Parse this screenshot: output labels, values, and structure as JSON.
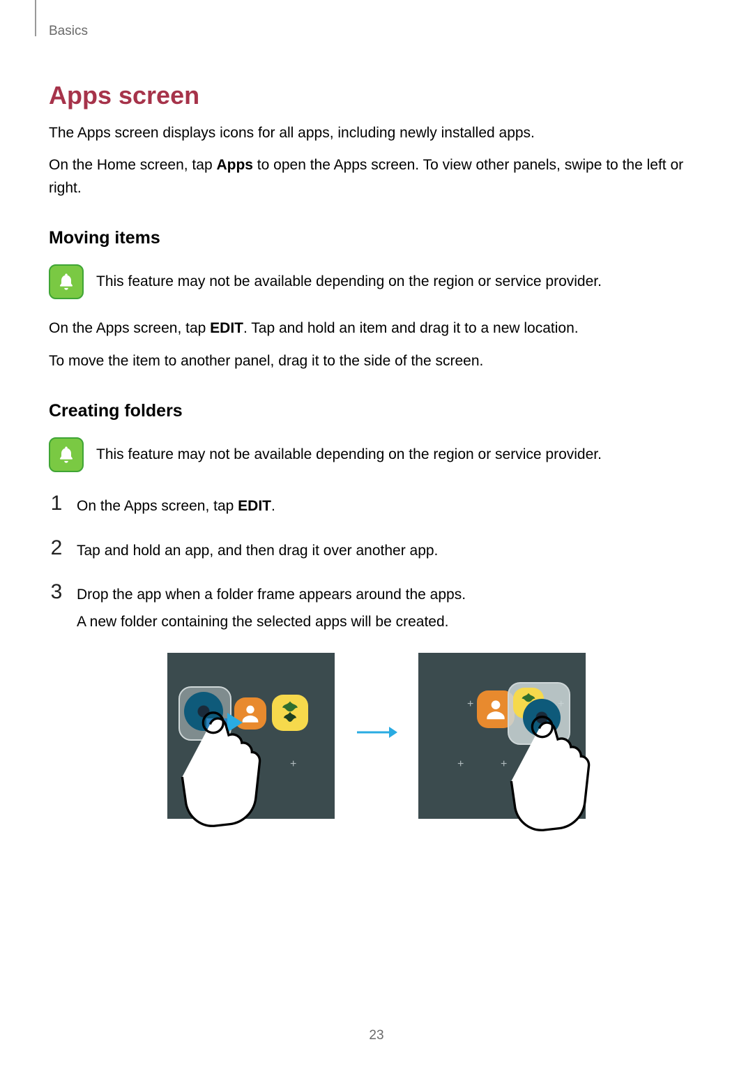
{
  "breadcrumb": "Basics",
  "heading": "Apps screen",
  "intro_paragraph": "The Apps screen displays icons for all apps, including newly installed apps.",
  "intro2_prefix": "On the Home screen, tap ",
  "intro2_bold": "Apps",
  "intro2_suffix": " to open the Apps screen. To view other panels, swipe to the left or right.",
  "section_moving_title": "Moving items",
  "note_text": "This feature may not be available depending on the region or service provider.",
  "moving_p1_prefix": "On the Apps screen, tap ",
  "moving_p1_bold": "EDIT",
  "moving_p1_suffix": ". Tap and hold an item and drag it to a new location.",
  "moving_p2": "To move the item to another panel, drag it to the side of the screen.",
  "section_folders_title": "Creating folders",
  "steps": {
    "n1": "1",
    "s1_prefix": "On the Apps screen, tap ",
    "s1_bold": "EDIT",
    "s1_suffix": ".",
    "n2": "2",
    "s2": "Tap and hold an app, and then drag it over another app.",
    "n3": "3",
    "s3_line1": "Drop the app when a folder frame appears around the apps.",
    "s3_line2": "A new folder containing the selected apps will be created."
  },
  "page_number": "23"
}
